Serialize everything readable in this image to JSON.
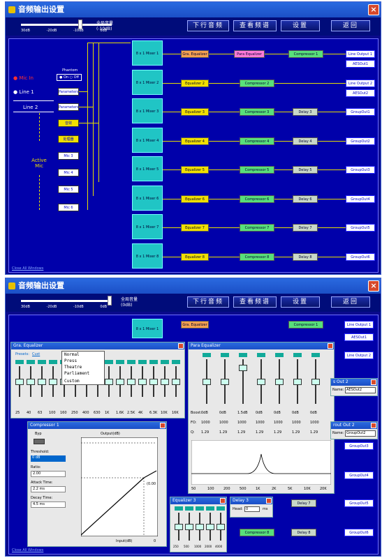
{
  "window": {
    "title": "音频输出设置",
    "close": "×"
  },
  "toolbar": {
    "volume_label": "全局音量",
    "volume_value": "(-10dB)",
    "volume_value_2": "(0dB)",
    "ticks": [
      "30dB",
      "-20dB",
      "-10dB",
      "0dB"
    ],
    "buttons": [
      "下行音频",
      "查看频谱",
      "设置",
      "返回"
    ]
  },
  "inputs": {
    "mic_in": "Mic In",
    "line1": "Line 1",
    "line2": "Line 2",
    "phantom": "Phantom",
    "on": "On",
    "off": "Off",
    "buttons": [
      "Parameters",
      "Parameters",
      "音效",
      "处理器",
      "Mic 3",
      "Mic 4",
      "Mic 5",
      "Mic 6"
    ],
    "active": "Active",
    "mic": "Mic"
  },
  "mixers": [
    "8 x 1 Mixer 1",
    "8 x 1 Mixer 2",
    "8 x 1 Mixer 3",
    "8 x 1 Mixer 4",
    "8 x 1 Mixer 5",
    "8 x 1 Mixer 6",
    "8 x 1 Mixer 7",
    "8 x 1 Mixer 8"
  ],
  "row1": {
    "eq": "Gra. Equalizer",
    "peq": "Para Equalizer",
    "comp": "Compressor 1",
    "out1": "Line Output 1",
    "out2": "AESOut1"
  },
  "row2": {
    "eq": "Equalizer 2",
    "comp": "Compressor 2",
    "out1": "Line Output 2",
    "out2": "AESOut2"
  },
  "rows": [
    {
      "eq": "Equalizer 3",
      "comp": "Compressor 3",
      "delay": "Delay 3",
      "out": "GroupOut1"
    },
    {
      "eq": "Equalizer 4",
      "comp": "Compressor 4",
      "delay": "Delay 4",
      "out": "GroupOut2"
    },
    {
      "eq": "Equalizer 5",
      "comp": "Compressor 5",
      "delay": "Delay 5",
      "out": "GroupOut3"
    },
    {
      "eq": "Equalizer 6",
      "comp": "Compressor 6",
      "delay": "Delay 6",
      "out": "GroupOut4"
    },
    {
      "eq": "Equalizer 7",
      "comp": "Compressor 7",
      "delay": "Delay 7",
      "out": "GroupOut5"
    },
    {
      "eq": "Equalizer 8",
      "comp": "Compressor 8",
      "delay": "Delay 8",
      "out": "GroupOut6"
    }
  ],
  "footer": "Close All Windows",
  "geq": {
    "title": "Gra. Equalizer",
    "presets_label": "Presets:",
    "preset": "Cust",
    "menu": [
      "Normal",
      "Press",
      "Theatre",
      "Parliament",
      "Custom"
    ],
    "bands": [
      "25",
      "40",
      "63",
      "100",
      "160",
      "250",
      "400",
      "630",
      "1K",
      "1.6K",
      "2.5K",
      "4K",
      "6.3K",
      "10K",
      "16K"
    ]
  },
  "peq": {
    "title": "Para Equalizer",
    "boost_label": "Boost:",
    "boost": [
      "0dB",
      "0dB",
      "1.5dB",
      "0dB",
      "0dB",
      "0dB",
      "0dB"
    ],
    "freq_label": "FO:",
    "freq": [
      "1000",
      "1000",
      "1000",
      "1000",
      "1000",
      "1000",
      "1000"
    ],
    "q_label": "Q:",
    "q": [
      "1.29",
      "1.29",
      "1.29",
      "1.29",
      "1.29",
      "1.29",
      "1.29"
    ],
    "axis": [
      "50",
      "100",
      "200",
      "500",
      "1K",
      "2K",
      "5K",
      "10K",
      "20K"
    ]
  },
  "comp": {
    "title": "Compressor 1",
    "byp": "Byp",
    "threshold_label": "Threshold:",
    "threshold": "0 dB",
    "ratio_label": "Ratio:",
    "ratio": "2.00",
    "attack_label": "Attack Time:",
    "attack": "2.2 ms",
    "decay_label": "Decay Time:",
    "decay": "4.5 ms",
    "output_label": "Output(dB)",
    "input_label": "Input(dB)",
    "point": "(0.00",
    "zero": "0"
  },
  "geq2": {
    "title": "Equalizer 3",
    "bands": [
      "250",
      "500",
      "1000",
      "2000",
      "4000"
    ]
  },
  "delay": {
    "title": "Delay 3",
    "label": "Head:",
    "value": "0",
    "unit": "ms"
  },
  "aes": {
    "title": "s Out 2",
    "name_label": "Name:",
    "name": "AESOut2"
  },
  "grp": {
    "title": "rout Out 2",
    "name_label": "Name:",
    "name": "GroupOut2"
  }
}
